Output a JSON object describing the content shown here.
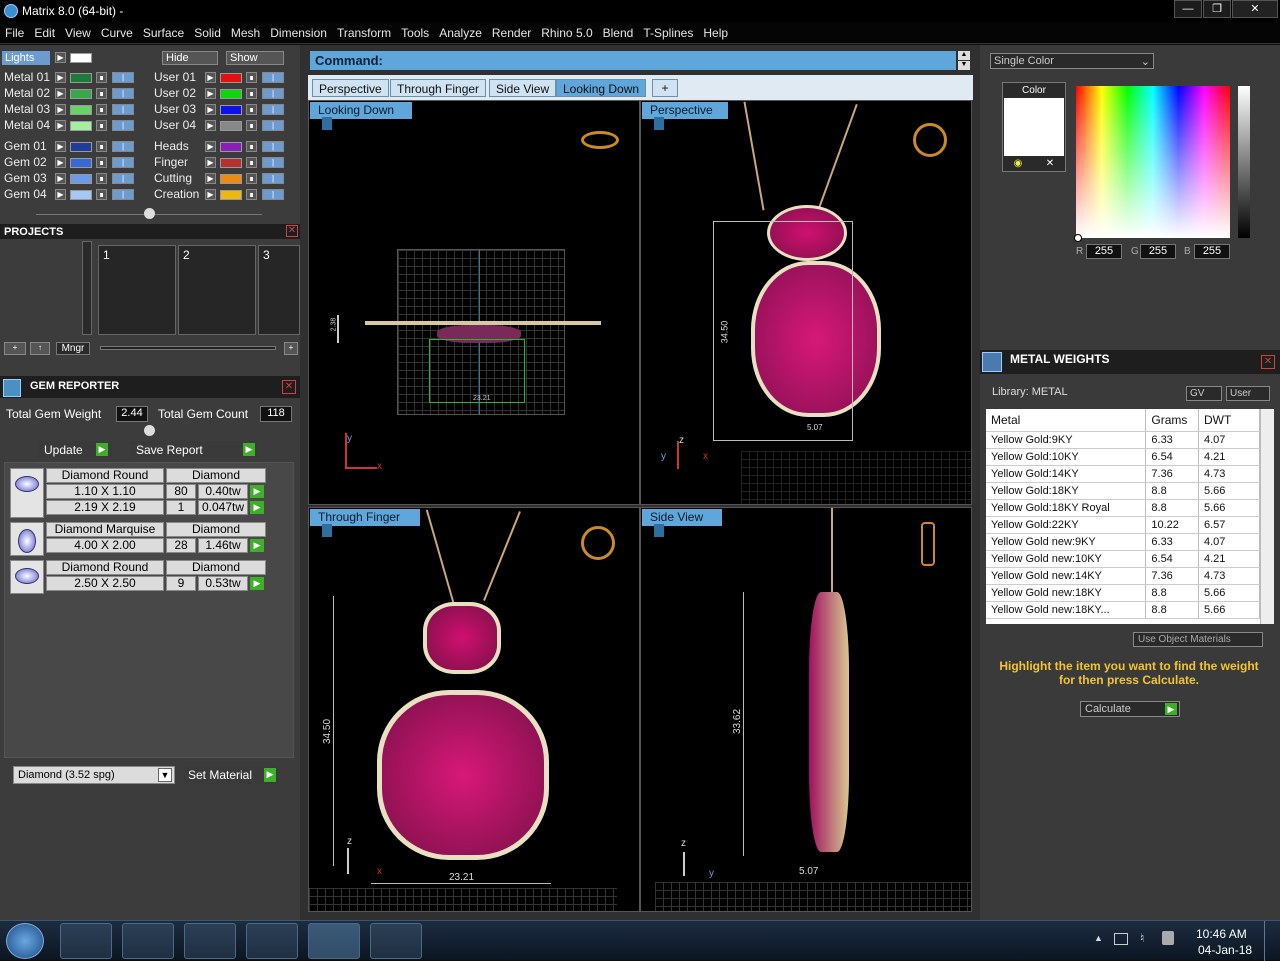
{
  "window": {
    "title": "Matrix 8.0 (64-bit) -"
  },
  "menu": [
    "File",
    "Edit",
    "View",
    "Curve",
    "Surface",
    "Solid",
    "Mesh",
    "Dimension",
    "Transform",
    "Tools",
    "Analyze",
    "Render",
    "Rhino 5.0",
    "Blend",
    "T-Splines",
    "Help"
  ],
  "layers": {
    "lights_label": "Lights",
    "hide_label": "Hide",
    "show_label": "Show",
    "left": [
      {
        "label": "Metal 01",
        "color": "#1e7a3a"
      },
      {
        "label": "Metal 02",
        "color": "#3aa84a"
      },
      {
        "label": "Metal 03",
        "color": "#6ad26a"
      },
      {
        "label": "Metal 04",
        "color": "#a6eea0"
      },
      {
        "label": "Gem 01",
        "color": "#1e3e9a"
      },
      {
        "label": "Gem 02",
        "color": "#3a68d2"
      },
      {
        "label": "Gem 03",
        "color": "#6a9ae8"
      },
      {
        "label": "Gem 04",
        "color": "#a6c6f4"
      }
    ],
    "right": [
      {
        "label": "User 01",
        "color": "#e21010"
      },
      {
        "label": "User 02",
        "color": "#10d410"
      },
      {
        "label": "User 03",
        "color": "#1010e8"
      },
      {
        "label": "User 04",
        "color": "#888888"
      },
      {
        "label": "Heads",
        "color": "#8a1eb8"
      },
      {
        "label": "Finger",
        "color": "#b83030"
      },
      {
        "label": "Cutting",
        "color": "#ee8a10"
      },
      {
        "label": "Creation",
        "color": "#eeb810"
      }
    ]
  },
  "projects": {
    "title": "PROJECTS",
    "slots": [
      "1",
      "2",
      "3"
    ],
    "mngr": "Mngr"
  },
  "gem_reporter": {
    "title": "GEM REPORTER",
    "total_weight_label": "Total Gem Weight",
    "total_weight": "2.44",
    "total_count_label": "Total Gem Count",
    "total_count": "118",
    "update": "Update",
    "save_report": "Save Report",
    "groups": [
      {
        "shape": "Diamond Round",
        "material": "Diamond",
        "rows": [
          {
            "size": "1.10 X 1.10",
            "count": "80",
            "tw": "0.40tw"
          },
          {
            "size": "2.19 X 2.19",
            "count": "1",
            "tw": "0.047tw"
          }
        ]
      },
      {
        "shape": "Diamond Marquise",
        "material": "Diamond",
        "rows": [
          {
            "size": "4.00 X 2.00",
            "count": "28",
            "tw": "1.46tw"
          }
        ]
      },
      {
        "shape": "Diamond Round",
        "material": "Diamond",
        "rows": [
          {
            "size": "2.50 X 2.50",
            "count": "9",
            "tw": "0.53tw"
          }
        ]
      }
    ],
    "material_select": "Diamond     (3.52 spg)",
    "set_material": "Set Material"
  },
  "command": {
    "label": "Command:"
  },
  "view_tabs": [
    "Perspective",
    "Through Finger",
    "Side View",
    "Looking Down"
  ],
  "active_tab": "Looking Down",
  "viewports": {
    "tl": {
      "label": "Looking Down",
      "dim_a": "2.38",
      "dim_b": "23.21"
    },
    "tr": {
      "label": "Perspective",
      "dim_a": "34.50",
      "dim_b": "5.07"
    },
    "bl": {
      "label": "Through Finger",
      "dim_a": "34.50",
      "dim_b": "23.21"
    },
    "br": {
      "label": "Side View",
      "dim_a": "33.62",
      "dim_b": "5.07"
    }
  },
  "axes": {
    "x": "x",
    "y": "y",
    "z": "z"
  },
  "color_panel": {
    "mode": "Single Color",
    "label": "Color",
    "r_label": "R",
    "r": "255",
    "g_label": "G",
    "g": "255",
    "b_label": "B",
    "b": "255"
  },
  "metal_weights": {
    "title": "METAL WEIGHTS",
    "library": "Library: METAL",
    "gv": "GV",
    "user": "User",
    "columns": [
      "Metal",
      "Grams",
      "DWT"
    ],
    "rows": [
      [
        "Yellow Gold:9KY",
        "6.33",
        "4.07"
      ],
      [
        "Yellow Gold:10KY",
        "6.54",
        "4.21"
      ],
      [
        "Yellow Gold:14KY",
        "7.36",
        "4.73"
      ],
      [
        "Yellow Gold:18KY",
        "8.8",
        "5.66"
      ],
      [
        "Yellow Gold:18KY Royal",
        "8.8",
        "5.66"
      ],
      [
        "Yellow Gold:22KY",
        "10.22",
        "6.57"
      ],
      [
        "Yellow Gold new:9KY",
        "6.33",
        "4.07"
      ],
      [
        "Yellow Gold new:10KY",
        "6.54",
        "4.21"
      ],
      [
        "Yellow Gold new:14KY",
        "7.36",
        "4.73"
      ],
      [
        "Yellow Gold new:18KY",
        "8.8",
        "5.66"
      ],
      [
        "Yellow Gold new:18KY...",
        "8.8",
        "5.66"
      ]
    ],
    "use_object_materials": "Use Object Materials",
    "hint": "Highlight the item you want to find the weight for then press Calculate.",
    "calculate": "Calculate"
  },
  "taskbar": {
    "time": "10:46 AM",
    "date": "04-Jan-18"
  }
}
